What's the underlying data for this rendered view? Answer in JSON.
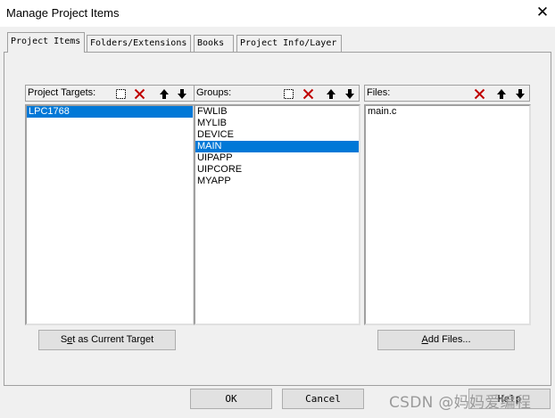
{
  "window": {
    "title": "Manage Project Items"
  },
  "tabs": [
    {
      "label": "Project Items",
      "active": true
    },
    {
      "label": "Folders/Extensions",
      "active": false
    },
    {
      "label": "Books",
      "active": false
    },
    {
      "label": "Project Info/Layer",
      "active": false
    }
  ],
  "targets": {
    "label": "Project Targets:",
    "items": [
      "LPC1768"
    ],
    "selected_index": 0
  },
  "groups": {
    "label": "Groups:",
    "items": [
      "FWLIB",
      "MYLIB",
      "DEVICE",
      "MAIN",
      "UIPAPP",
      "UIPCORE",
      "MYAPP"
    ],
    "selected_index": 3
  },
  "files": {
    "label": "Files:",
    "items": [
      "main.c"
    ]
  },
  "buttons": {
    "set_target_prefix": "S",
    "set_target_underline": "e",
    "set_target_rest": "t as Current Target",
    "add_files_prefix": "",
    "add_files_underline": "A",
    "add_files_rest": "dd Files...",
    "ok": "OK",
    "cancel": "Cancel",
    "help": "Help"
  },
  "icons": {
    "new": "new-item-icon",
    "delete": "delete-icon",
    "up": "move-up-icon",
    "down": "move-down-icon",
    "close": "close-icon"
  },
  "colors": {
    "selection": "#0078d7",
    "delete_red": "#c00000"
  },
  "watermark": "CSDN @妈妈爱编程"
}
